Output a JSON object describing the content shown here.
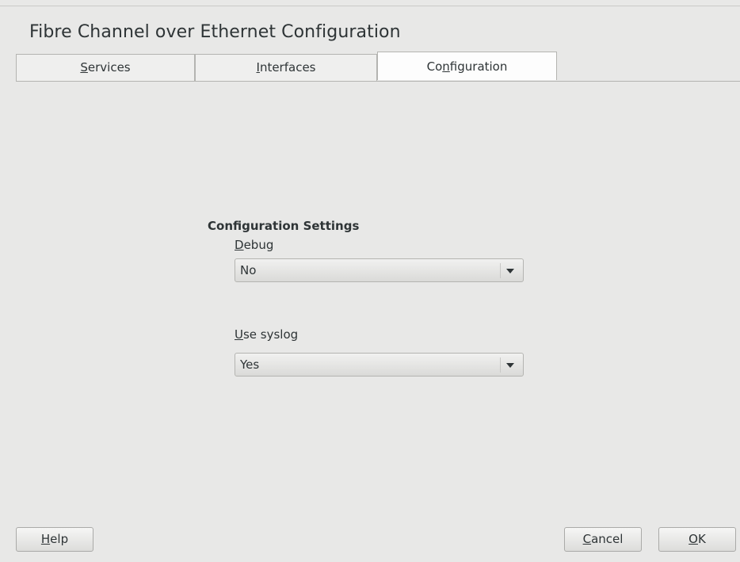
{
  "window": {
    "title": "Fibre Channel over Ethernet Configuration"
  },
  "tabs": [
    {
      "label": "Services",
      "mnemonic": "S",
      "rest": "ervices",
      "active": false
    },
    {
      "label": "Interfaces",
      "mnemonic": "I",
      "rest": "nterfaces",
      "active": false
    },
    {
      "label": "Configuration",
      "pre": "Co",
      "mnemonic": "n",
      "rest": "figuration",
      "active": true
    }
  ],
  "section": {
    "title": "Configuration Settings"
  },
  "fields": {
    "debug": {
      "label": "Debug",
      "mnemonic": "D",
      "rest": "ebug",
      "value": "No"
    },
    "syslog": {
      "label": "Use syslog",
      "mnemonic": "U",
      "rest": "se syslog",
      "value": "Yes"
    }
  },
  "buttons": {
    "help": {
      "label": "Help",
      "mnemonic": "H",
      "rest": "elp"
    },
    "cancel": {
      "label": "Cancel",
      "mnemonic": "C",
      "rest": "ancel"
    },
    "ok": {
      "label": "OK",
      "mnemonic": "O",
      "rest": "K"
    }
  },
  "icons": {
    "combo_arrow": "chevron-down-icon"
  }
}
